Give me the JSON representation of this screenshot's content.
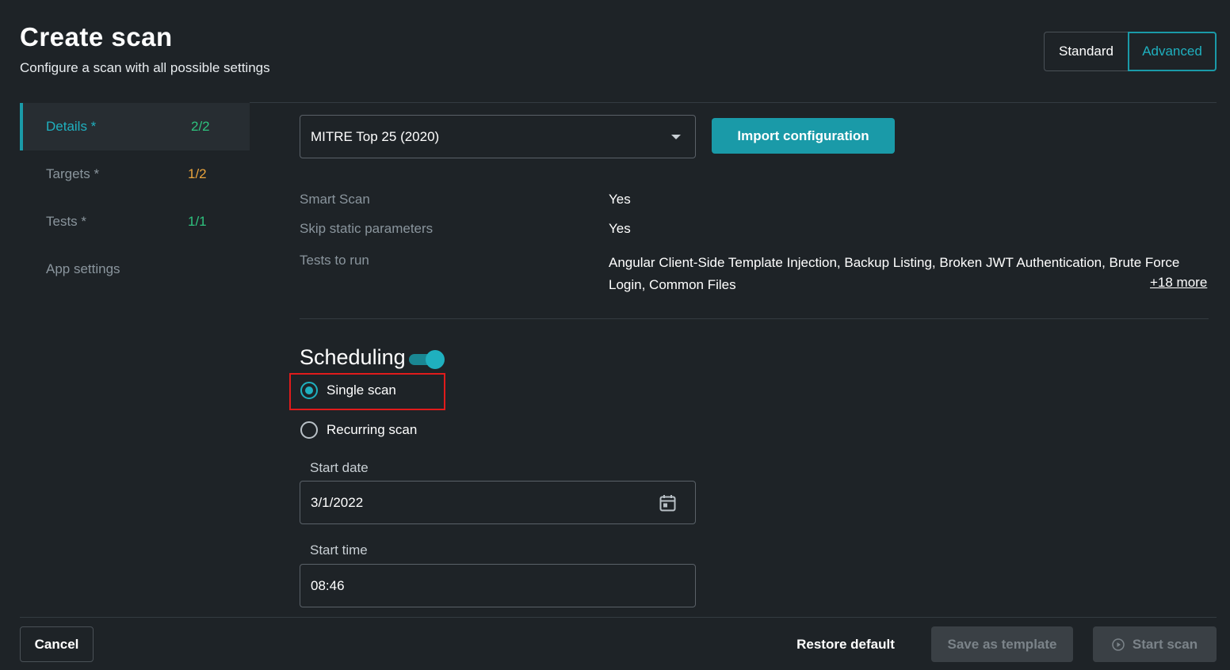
{
  "header": {
    "title": "Create scan",
    "subtitle": "Configure a scan with all possible settings",
    "mode_standard": "Standard",
    "mode_advanced": "Advanced",
    "active_mode": "Advanced"
  },
  "sidebar": {
    "items": [
      {
        "label": "Details *",
        "count": "2/2",
        "active": true
      },
      {
        "label": "Targets *",
        "count": "1/2",
        "active": false
      },
      {
        "label": "Tests *",
        "count": "1/1",
        "active": false
      },
      {
        "label": "App settings",
        "count": "",
        "active": false
      }
    ]
  },
  "template_select": {
    "value": "MITRE Top 25 (2020)"
  },
  "import_button": "Import configuration",
  "summary": {
    "smart_scan_label": "Smart Scan",
    "smart_scan_value": "Yes",
    "skip_static_label": "Skip static parameters",
    "skip_static_value": "Yes",
    "tests_label": "Tests to run",
    "tests_value": "Angular Client-Side Template Injection, Backup Listing, Broken JWT Authentication, Brute Force Login, Common Files",
    "more_link": "+18 more"
  },
  "scheduling": {
    "title": "Scheduling",
    "enabled": true,
    "single_scan_label": "Single scan",
    "recurring_scan_label": "Recurring scan",
    "selected": "Single scan",
    "start_date_label": "Start date",
    "start_date_value": "3/1/2022",
    "start_time_label": "Start time",
    "start_time_value": "08:46"
  },
  "footer": {
    "cancel": "Cancel",
    "restore_default": "Restore default",
    "save_as_template": "Save as template",
    "start_scan": "Start scan"
  },
  "colors": {
    "accent": "#1a9aa8",
    "background": "#1e2327",
    "highlight": "#e01b1b",
    "count_green": "#2ec27e",
    "count_orange": "#e8a33d"
  }
}
